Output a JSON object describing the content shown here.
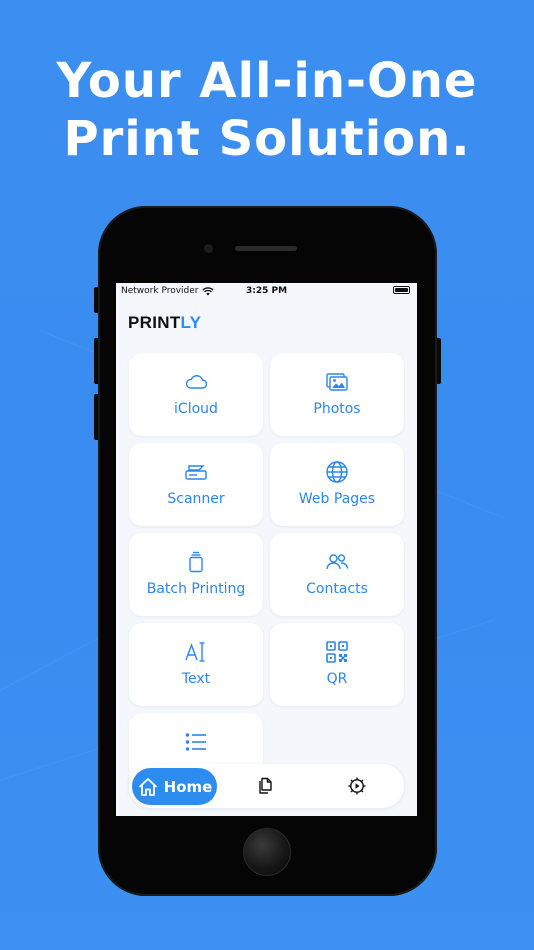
{
  "headline": {
    "line1": "Your All-in-One",
    "line2": "Print Solution."
  },
  "status_bar": {
    "carrier": "Network Provider",
    "time": "3:25 PM"
  },
  "app": {
    "logo_part1": "PRINT",
    "logo_part2": "LY",
    "accent_color": "#2d8cf0"
  },
  "grid": {
    "items": [
      {
        "label": "iCloud",
        "icon": "cloud-icon"
      },
      {
        "label": "Photos",
        "icon": "photos-icon"
      },
      {
        "label": "Scanner",
        "icon": "scanner-icon"
      },
      {
        "label": "Web Pages",
        "icon": "globe-icon"
      },
      {
        "label": "Batch Printing",
        "icon": "batch-icon"
      },
      {
        "label": "Contacts",
        "icon": "contacts-icon"
      },
      {
        "label": "Text",
        "icon": "text-icon"
      },
      {
        "label": "QR",
        "icon": "qr-icon"
      },
      {
        "label": "",
        "icon": "list-icon"
      }
    ]
  },
  "tabbar": {
    "home_label": "Home",
    "tabs": [
      "home-icon",
      "documents-icon",
      "settings-icon"
    ]
  }
}
